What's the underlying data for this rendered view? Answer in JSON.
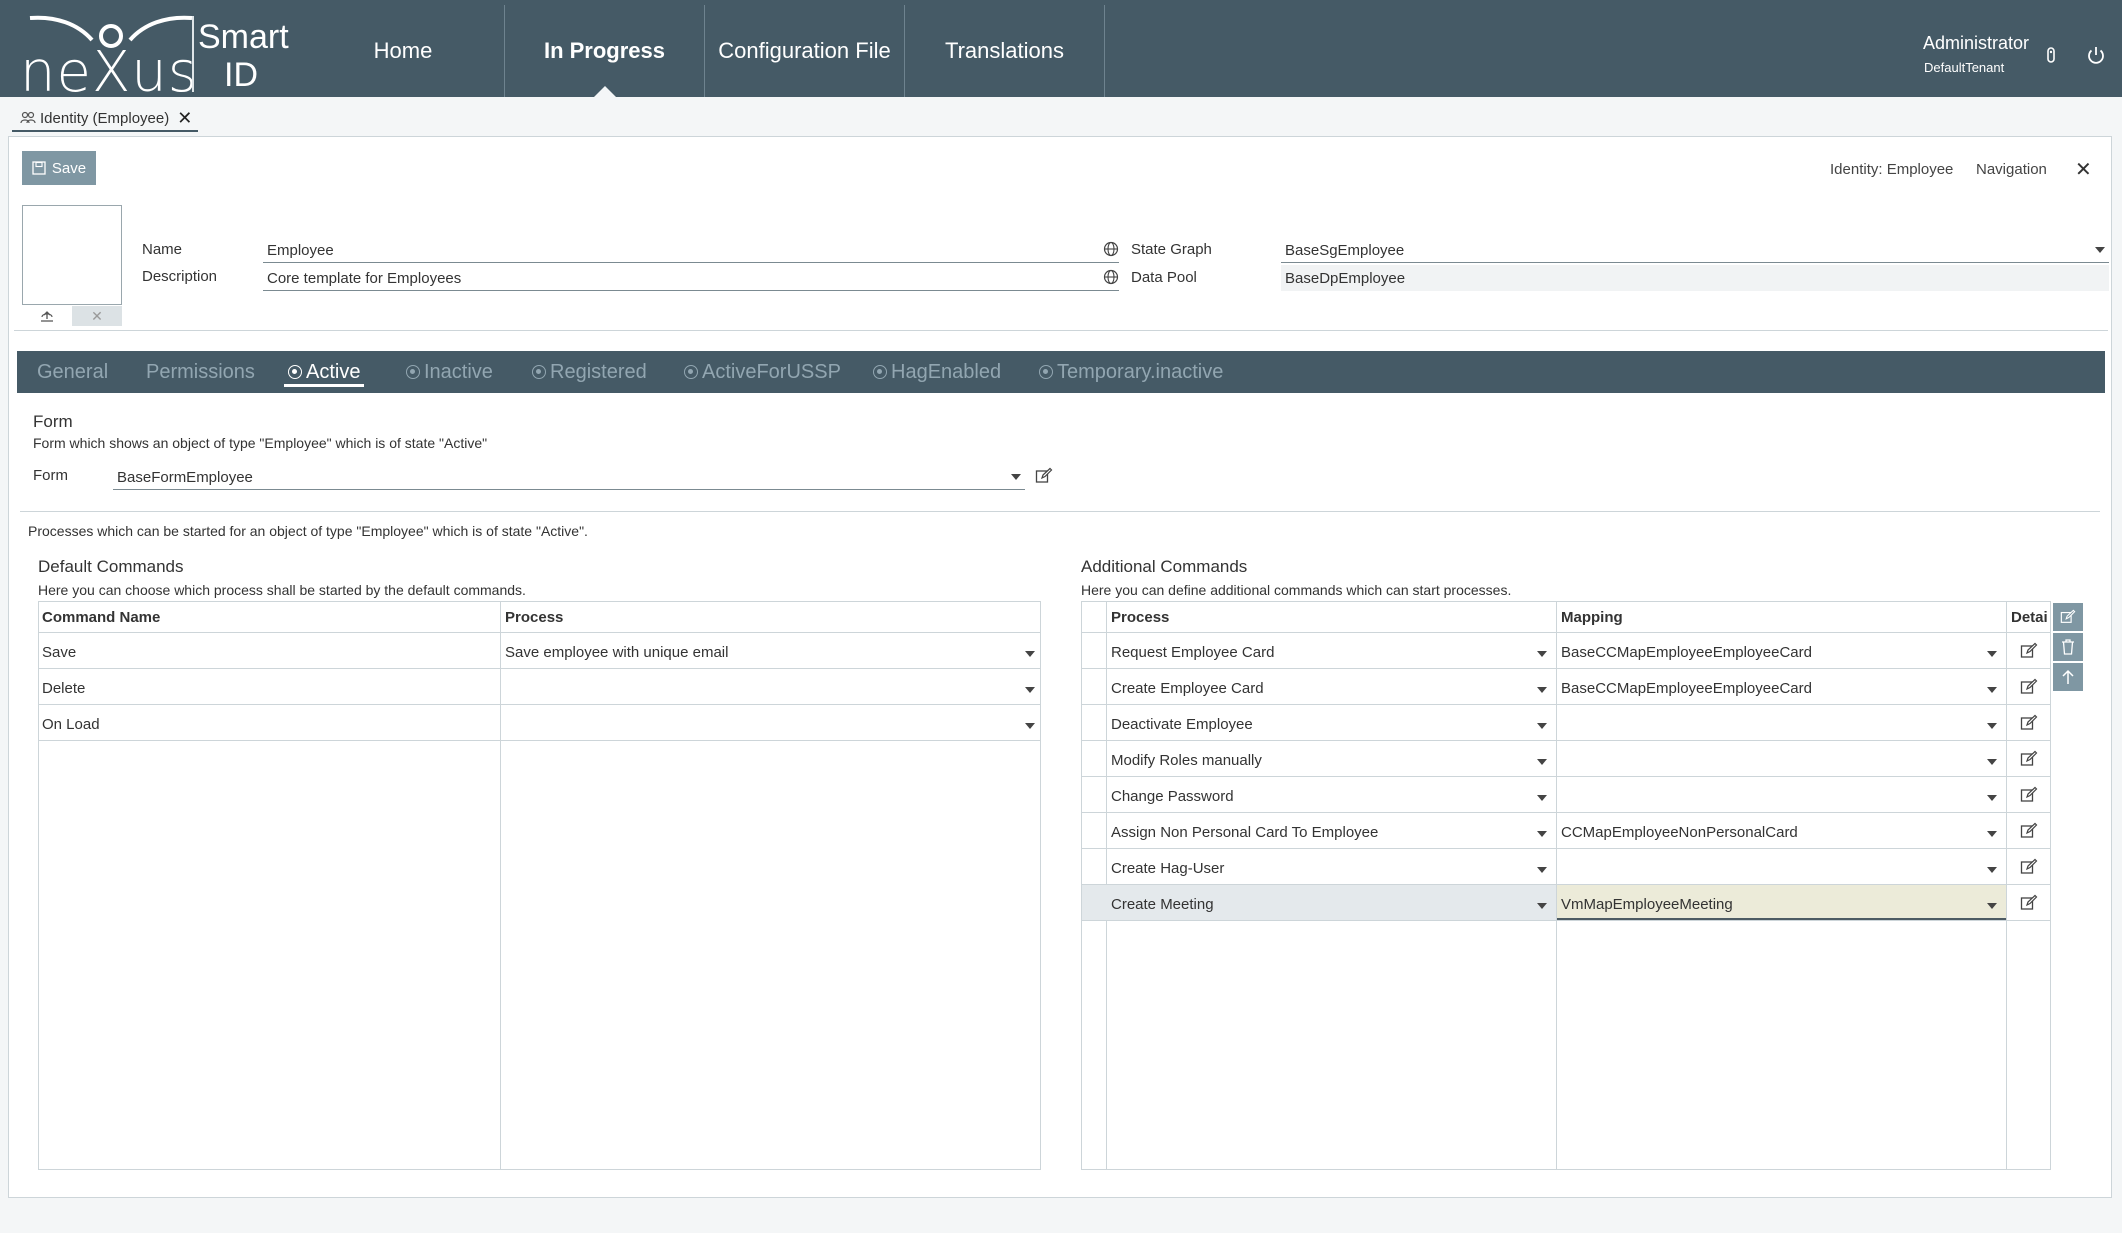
{
  "brand": {
    "logo_text": "neXus",
    "product_line1": "Smart",
    "product_line2": "ID"
  },
  "nav": {
    "home": "Home",
    "in_progress": "In Progress",
    "configuration_file": "Configuration File",
    "translations": "Translations"
  },
  "user": {
    "name": "Administrator",
    "tenant": "DefaultTenant"
  },
  "doc_tab": {
    "label": "Identity (Employee)"
  },
  "toolbar": {
    "save_label": "Save",
    "identity_link": "Identity: Employee",
    "navigation_link": "Navigation"
  },
  "fields": {
    "name_label": "Name",
    "name_value": "Employee",
    "description_label": "Description",
    "description_value": "Core template for Employees",
    "state_graph_label": "State Graph",
    "state_graph_value": "BaseSgEmployee",
    "data_pool_label": "Data Pool",
    "data_pool_value": "BaseDpEmployee"
  },
  "subtabs": [
    {
      "label": "General",
      "radio": false,
      "active": false
    },
    {
      "label": "Permissions",
      "radio": false,
      "active": false
    },
    {
      "label": "Active",
      "radio": true,
      "active": true
    },
    {
      "label": "Inactive",
      "radio": true,
      "active": false
    },
    {
      "label": "Registered",
      "radio": true,
      "active": false
    },
    {
      "label": "ActiveForUSSP",
      "radio": true,
      "active": false
    },
    {
      "label": "HagEnabled",
      "radio": true,
      "active": false
    },
    {
      "label": "Temporary.inactive",
      "radio": true,
      "active": false
    }
  ],
  "form_section": {
    "title": "Form",
    "description": "Form which shows an object of type \"Employee\" which is of state \"Active\"",
    "form_label": "Form",
    "form_value": "BaseFormEmployee"
  },
  "processes_text": "Processes which can be started for an object of type \"Employee\" which is of state \"Active\".",
  "default_commands": {
    "title": "Default Commands",
    "description": "Here you can choose which process shall be started by the default commands.",
    "col_command": "Command Name",
    "col_process": "Process",
    "rows": [
      {
        "command": "Save",
        "process": "Save employee with unique email"
      },
      {
        "command": "Delete",
        "process": ""
      },
      {
        "command": "On Load",
        "process": ""
      }
    ]
  },
  "additional_commands": {
    "title": "Additional Commands",
    "description": "Here you can define additional commands which can start processes.",
    "col_process": "Process",
    "col_mapping": "Mapping",
    "col_detail": "Detai",
    "rows": [
      {
        "process": "Request Employee Card",
        "mapping": "BaseCCMapEmployeeEmployeeCard"
      },
      {
        "process": "Create Employee Card",
        "mapping": "BaseCCMapEmployeeEmployeeCard"
      },
      {
        "process": "Deactivate Employee",
        "mapping": ""
      },
      {
        "process": "Modify Roles manually",
        "mapping": ""
      },
      {
        "process": "Change Password",
        "mapping": ""
      },
      {
        "process": "Assign Non Personal Card To Employee",
        "mapping": "CCMapEmployeeNonPersonalCard"
      },
      {
        "process": "Create Hag-User",
        "mapping": ""
      },
      {
        "process": "Create Meeting",
        "mapping": "VmMapEmployeeMeeting"
      }
    ],
    "selected_row": 7
  },
  "colors": {
    "header_bg": "#455a66",
    "button_bg": "#7f97a3",
    "tab_inactive": "#92a6b1"
  }
}
